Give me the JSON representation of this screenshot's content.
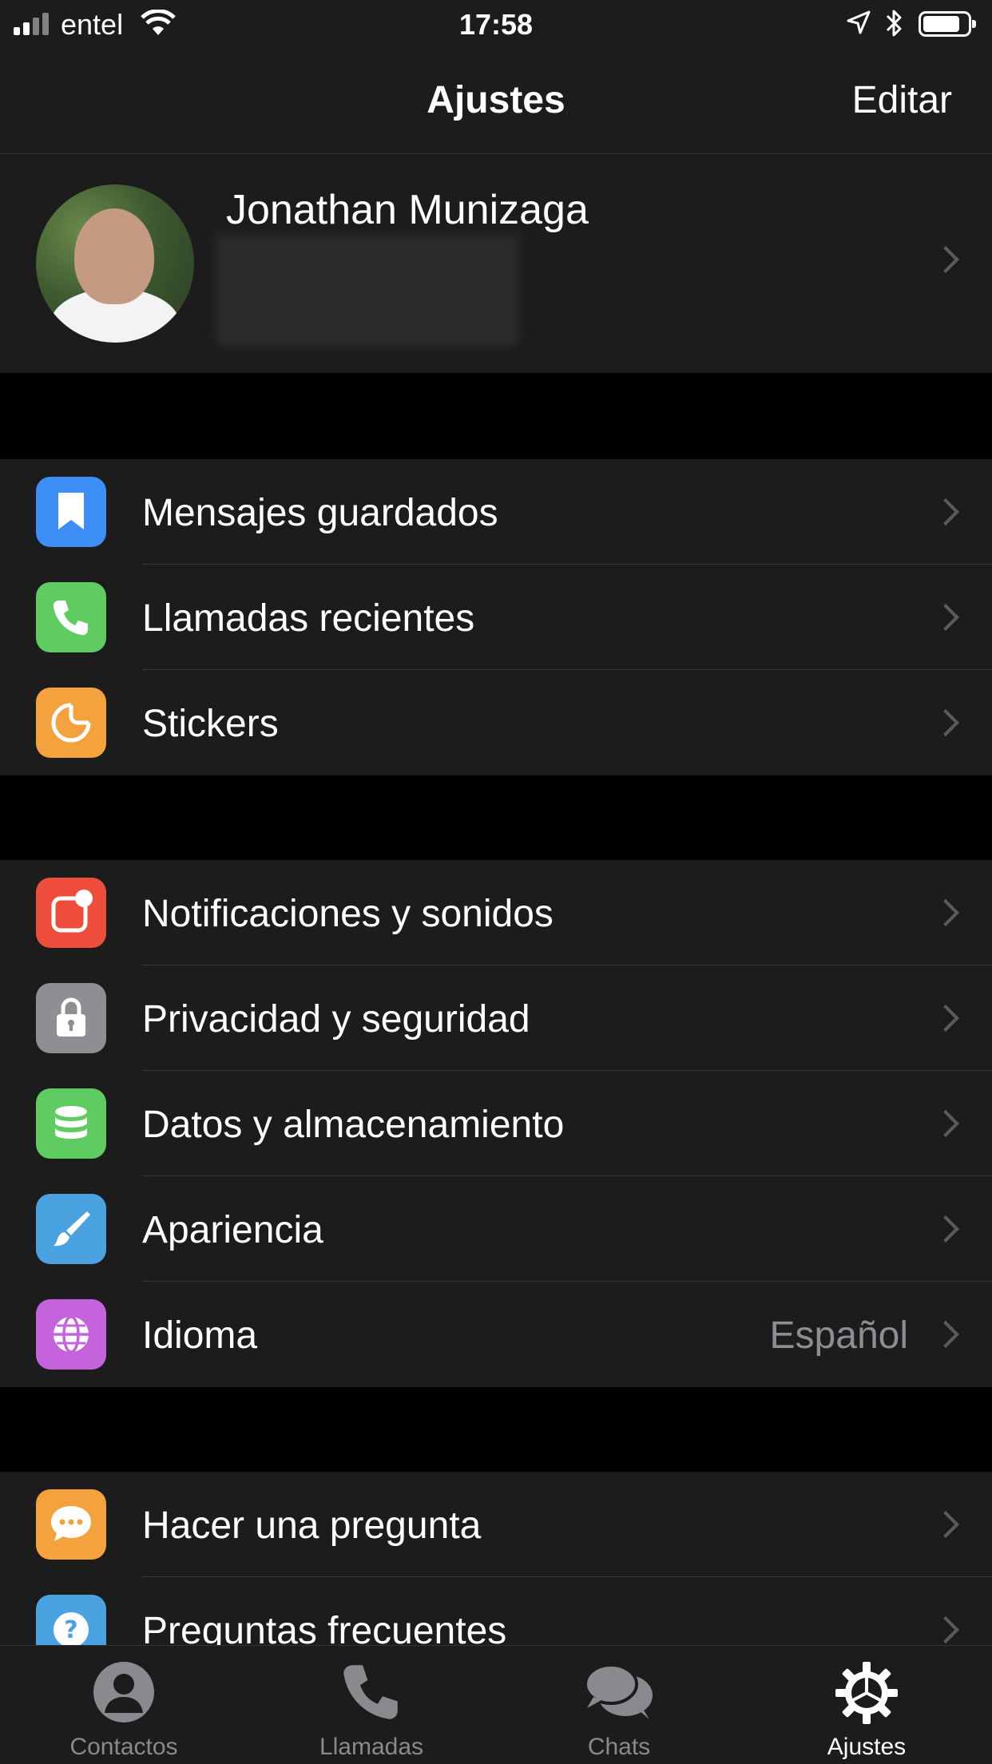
{
  "status_bar": {
    "carrier": "entel",
    "time": "17:58"
  },
  "nav": {
    "title": "Ajustes",
    "edit_label": "Editar"
  },
  "profile": {
    "name": "Jonathan Munizaga",
    "phone_redacted": true
  },
  "groups": [
    {
      "items": [
        {
          "label": "Mensajes guardados",
          "icon": "bookmark-icon",
          "color": "#3e8ef7"
        },
        {
          "label": "Llamadas recientes",
          "icon": "phone-icon",
          "color": "#5fcc62"
        },
        {
          "label": "Stickers",
          "icon": "sticker-icon",
          "color": "#f4a23e"
        }
      ]
    },
    {
      "items": [
        {
          "label": "Notificaciones y sonidos",
          "icon": "notification-icon",
          "color": "#ef4d3c"
        },
        {
          "label": "Privacidad y seguridad",
          "icon": "lock-icon",
          "color": "#8e8e93"
        },
        {
          "label": "Datos y almacenamiento",
          "icon": "database-icon",
          "color": "#5fcc62"
        },
        {
          "label": "Apariencia",
          "icon": "brush-icon",
          "color": "#4aa3e0"
        },
        {
          "label": "Idioma",
          "value": "Español",
          "icon": "globe-icon",
          "color": "#c463dc"
        }
      ]
    },
    {
      "items": [
        {
          "label": "Hacer una pregunta",
          "icon": "chat-bubble-icon",
          "color": "#f4a23e"
        },
        {
          "label": "Preguntas frecuentes",
          "icon": "question-icon",
          "color": "#4aa3e0"
        }
      ]
    }
  ],
  "tab_bar": {
    "tabs": [
      {
        "label": "Contactos",
        "icon": "person-icon",
        "active": false
      },
      {
        "label": "Llamadas",
        "icon": "phone-icon",
        "active": false
      },
      {
        "label": "Chats",
        "icon": "chat-bubbles-icon",
        "active": false
      },
      {
        "label": "Ajustes",
        "icon": "settings-icon",
        "active": true
      }
    ]
  },
  "colors": {
    "background": "#000000",
    "surface": "#1c1c1d",
    "text": "#ffffff",
    "secondary_text": "#8d8d93"
  }
}
